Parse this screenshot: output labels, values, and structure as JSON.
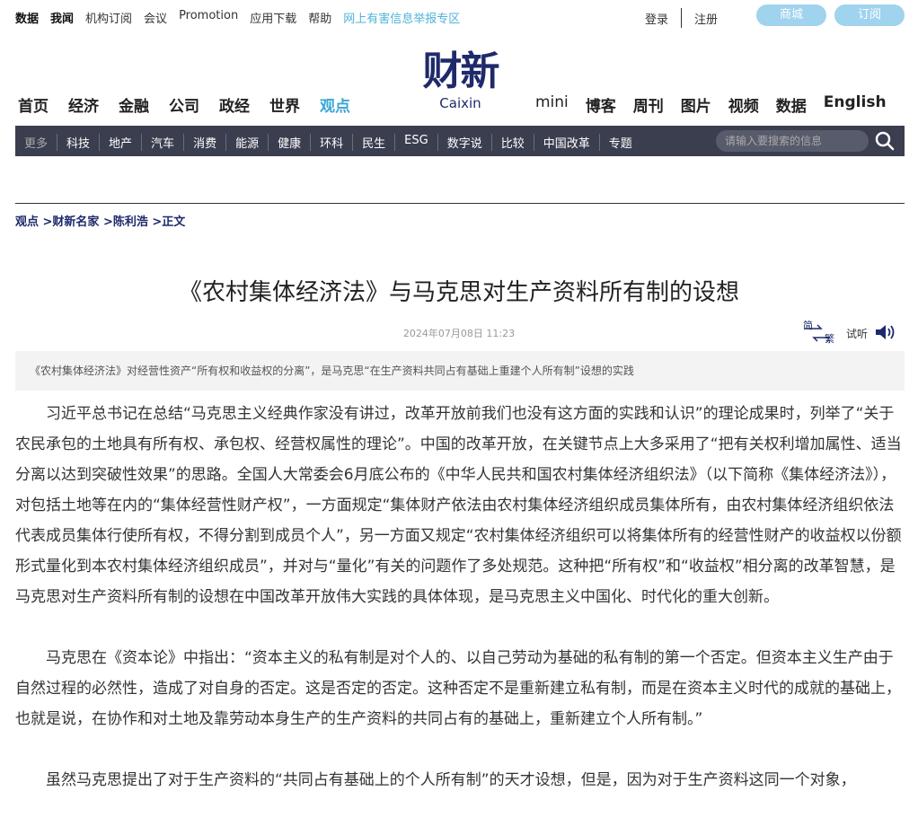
{
  "topbar": {
    "links": [
      "数据",
      "我闻",
      "机构订阅",
      "会议",
      "Promotion",
      "应用下载",
      "帮助",
      "网上有害信息举报专区"
    ],
    "login": "登录",
    "register": "注册",
    "shop": "商城",
    "subscribe": "订阅"
  },
  "logo": {
    "cn": "财新",
    "en": "Caixin"
  },
  "mainnav": {
    "left": [
      "首页",
      "经济",
      "金融",
      "公司",
      "政经",
      "世界",
      "观点"
    ],
    "right": [
      "mini",
      "博客",
      "周刊",
      "图片",
      "视频",
      "数据",
      "English"
    ]
  },
  "subnav": {
    "items": [
      "更多",
      "科技",
      "地产",
      "汽车",
      "消费",
      "能源",
      "健康",
      "环科",
      "民生",
      "ESG",
      "数字说",
      "比较",
      "中国改革",
      "专题"
    ],
    "search_placeholder": "请输入要搜索的信息"
  },
  "breadcrumb": "观点 >财新名家 >陈利浩 >正文",
  "article": {
    "title": "《农村集体经济法》与马克思对生产资料所有制的设想",
    "date": "2024年07月08日 11:23",
    "trad_simplified": [
      "简",
      "繁"
    ],
    "listen": "试听",
    "summary": "《农村集体经济法》对经营性资产“所有权和收益权的分离”，是马克思“在生产资料共同占有基础上重建个人所有制”设想的实践",
    "paragraphs": [
      "习近平总书记在总结“马克思主义经典作家没有讲过，改革开放前我们也没有这方面的实践和认识”的理论成果时，列举了“关于农民承包的土地具有所有权、承包权、经营权属性的理论”。中国的改革开放，在关键节点上大多采用了“把有关权利增加属性、适当分离以达到突破性效果”的思路。全国人大常委会6月底公布的《中华人民共和国农村集体经济组织法》（以下简称《集体经济法》），对包括土地等在内的“集体经营性财产权”，一方面规定“集体财产依法由农村集体经济组织成员集体所有，由农村集体经济组织依法代表成员集体行使所有权，不得分割到成员个人”，另一方面又规定“农村集体经济组织可以将集体所有的经营性财产的收益权以份额形式量化到本农村集体经济组织成员”，并对与“量化”有关的问题作了多处规范。这种把“所有权”和“收益权”相分离的改革智慧，是马克思对生产资料所有制的设想在中国改革开放伟大实践的具体体现，是马克思主义中国化、时代化的重大创新。",
      "马克思在《资本论》中指出：“资本主义的私有制是对个人的、以自己劳动为基础的私有制的第一个否定。但资本主义生产由于自然过程的必然性，造成了对自身的否定。这是否定的否定。这种否定不是重新建立私有制，而是在资本主义时代的成就的基础上，也就是说，在协作和对土地及靠劳动本身生产的生产资料的共同占有的基础上，重新建立个人所有制。”",
      "虽然马克思提出了对于生产资料的“共同占有基础上的个人所有制”的天才设想，但是，因为对于生产资料这同一个对象，"
    ]
  },
  "colors": {
    "brand": "#1e2a6b",
    "accent": "#39a6d4",
    "subnav_bg": "#3b3e4f",
    "pill": "#9fd3ee"
  }
}
